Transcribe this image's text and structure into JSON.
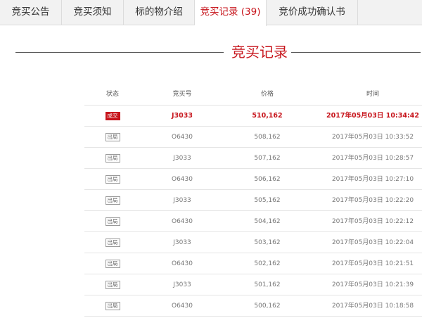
{
  "tabs": [
    {
      "label": "竞买公告"
    },
    {
      "label": "竞买须知"
    },
    {
      "label": "标的物介绍"
    },
    {
      "label": "竞买记录 (39)"
    },
    {
      "label": "竞价成功确认书"
    }
  ],
  "active_tab_index": 3,
  "section_title": "竞买记录",
  "table": {
    "headers": [
      "状态",
      "竞买号",
      "价格",
      "时间"
    ],
    "rows": [
      {
        "status": "成交",
        "bidder": "J3033",
        "price": "510,162",
        "time": "2017年05月03日 10:34:42"
      },
      {
        "status": "出局",
        "bidder": "O6430",
        "price": "508,162",
        "time": "2017年05月03日 10:33:52"
      },
      {
        "status": "出局",
        "bidder": "J3033",
        "price": "507,162",
        "time": "2017年05月03日 10:28:57"
      },
      {
        "status": "出局",
        "bidder": "O6430",
        "price": "506,162",
        "time": "2017年05月03日 10:27:10"
      },
      {
        "status": "出局",
        "bidder": "J3033",
        "price": "505,162",
        "time": "2017年05月03日 10:22:20"
      },
      {
        "status": "出局",
        "bidder": "O6430",
        "price": "504,162",
        "time": "2017年05月03日 10:22:12"
      },
      {
        "status": "出局",
        "bidder": "J3033",
        "price": "503,162",
        "time": "2017年05月03日 10:22:04"
      },
      {
        "status": "出局",
        "bidder": "O6430",
        "price": "502,162",
        "time": "2017年05月03日 10:21:51"
      },
      {
        "status": "出局",
        "bidder": "J3033",
        "price": "501,162",
        "time": "2017年05月03日 10:21:39"
      },
      {
        "status": "出局",
        "bidder": "O6430",
        "price": "500,162",
        "time": "2017年05月03日 10:18:58"
      }
    ]
  },
  "colors": {
    "accent": "#c7151c",
    "tab_bg": "#f2f2f2"
  }
}
